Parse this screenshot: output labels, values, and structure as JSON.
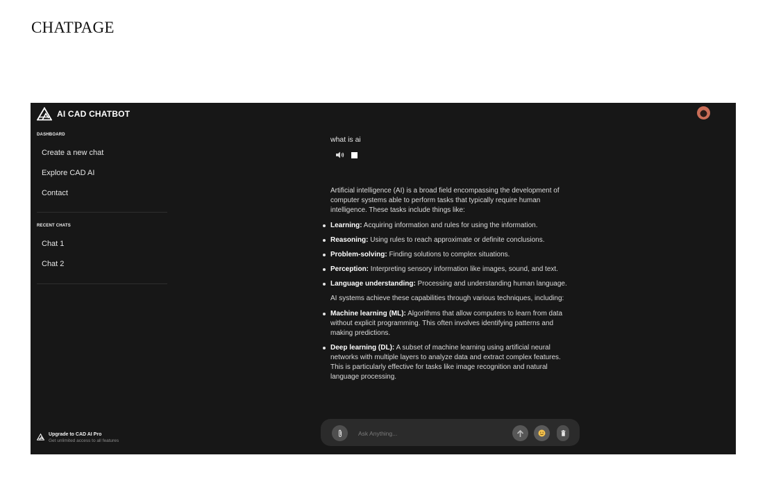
{
  "page_heading": "CHATPAGE",
  "app": {
    "brand": "AI CAD CHATBOT",
    "sidebar": {
      "dashboard_label": "DASHBOARD",
      "nav_items": [
        "Create a new chat",
        "Explore CAD AI",
        "Contact"
      ],
      "recent_label": "RECENT CHATS",
      "recent_chats": [
        "Chat 1",
        "Chat 2"
      ],
      "upgrade_title": "Upgrade to CAD AI Pro",
      "upgrade_subtitle": "Get unlimited access to all features"
    },
    "chat": {
      "user_message": "what is ai",
      "answer_intro": "Artificial intelligence (AI) is a broad field encompassing the development of computer systems able to perform tasks that typically require human intelligence. These tasks include things like:",
      "capabilities": [
        {
          "term": "Learning:",
          "desc": " Acquiring information and rules for using the information."
        },
        {
          "term": "Reasoning:",
          "desc": " Using rules to reach approximate or definite conclusions."
        },
        {
          "term": "Problem-solving:",
          "desc": " Finding solutions to complex situations."
        },
        {
          "term": "Perception:",
          "desc": " Interpreting sensory information like images, sound, and text."
        },
        {
          "term": "Language understanding:",
          "desc": " Processing and understanding human language."
        }
      ],
      "techniques_intro": "AI systems achieve these capabilities through various techniques, including:",
      "techniques": [
        {
          "term": "Machine learning (ML):",
          "desc": " Algorithms that allow computers to learn from data without explicit programming. This often involves identifying patterns and making predictions."
        },
        {
          "term": "Deep learning (DL):",
          "desc": " A subset of machine learning using artificial neural networks with multiple layers to analyze data and extract complex features. This is particularly effective for tasks like image recognition and natural language processing."
        }
      ]
    },
    "input": {
      "placeholder": "Ask Anything..."
    },
    "icons": {
      "brand": "triangle-logo-icon",
      "speaker": "speaker-icon",
      "stop": "stop-icon",
      "attach": "paperclip-icon",
      "send": "arrow-up-icon",
      "emoji": "emoji-icon",
      "delete": "trash-icon"
    },
    "colors": {
      "background": "#171717",
      "input_bar": "#2b2b2b",
      "emoji": "#f2c14e"
    }
  }
}
